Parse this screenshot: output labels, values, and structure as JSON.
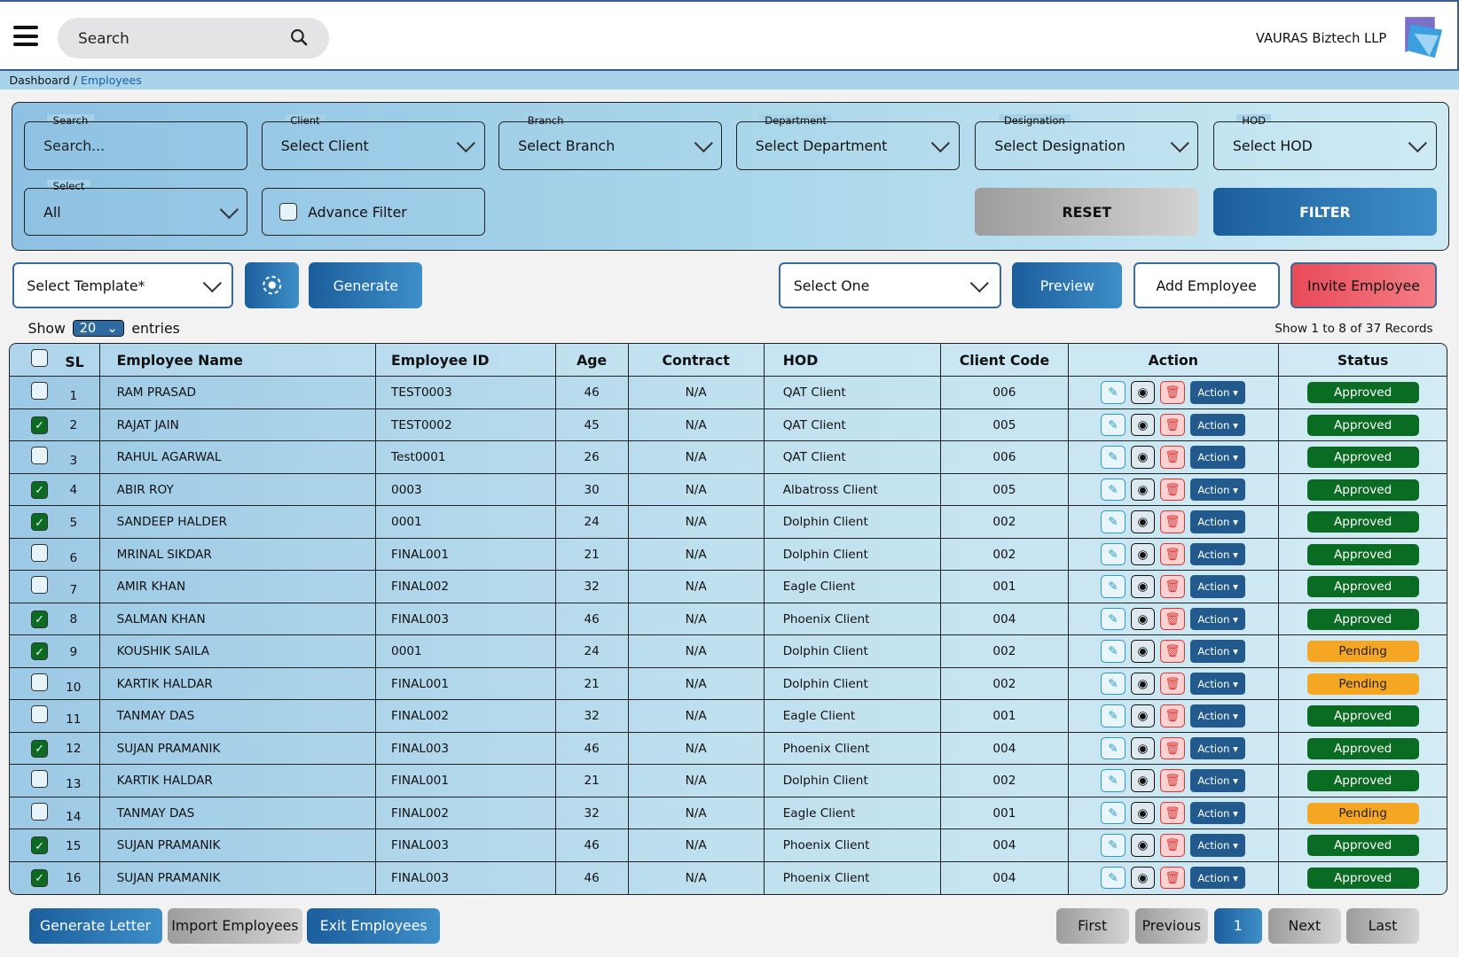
{
  "header": {
    "search_placeholder": "Search",
    "company": "VAURAS Biztech LLP"
  },
  "breadcrumb": {
    "root": "Dashboard",
    "separator": " / ",
    "current": "Employees"
  },
  "filters": {
    "search": {
      "label": "Search",
      "placeholder": "Search..."
    },
    "client": {
      "label": "Client",
      "value": "Select Client"
    },
    "branch": {
      "label": "Branch",
      "value": "Select Branch"
    },
    "department": {
      "label": "Department",
      "value": "Select Department"
    },
    "designation": {
      "label": "Designation",
      "value": "Select Designation"
    },
    "hod": {
      "label": "HOD",
      "value": "Select HOD"
    },
    "select": {
      "label": "Select",
      "value": "All"
    },
    "advance_filter": "Advance Filter",
    "reset": "RESET",
    "filter": "FILTER"
  },
  "toolbar": {
    "template": "Select Template*",
    "generate": "Generate",
    "select_one": "Select One",
    "preview": "Preview",
    "add_employee": "Add Employee",
    "invite_employee": "Invite Employee"
  },
  "entries": {
    "show": "Show",
    "value": "20",
    "entries": "entries",
    "summary": "Show 1 to 8 of 37 Records"
  },
  "table": {
    "headers": [
      "SL",
      "Employee Name",
      "Employee ID",
      "Age",
      "Contract",
      "HOD",
      "Client Code",
      "Action",
      "Status"
    ],
    "action_label": "Action",
    "rows": [
      {
        "checked": false,
        "sl": "1",
        "name": "RAM PRASAD",
        "id": "TEST0003",
        "age": "46",
        "contract": "N/A",
        "hod": "QAT Client",
        "code": "006",
        "status": "Approved"
      },
      {
        "checked": true,
        "sl": "2",
        "name": "RAJAT JAIN",
        "id": "TEST0002",
        "age": "45",
        "contract": "N/A",
        "hod": "QAT Client",
        "code": "005",
        "status": "Approved"
      },
      {
        "checked": false,
        "sl": "3",
        "name": "RAHUL AGARWAL",
        "id": "Test0001",
        "age": "26",
        "contract": "N/A",
        "hod": "QAT Client",
        "code": "006",
        "status": "Approved"
      },
      {
        "checked": true,
        "sl": "4",
        "name": "ABIR ROY",
        "id": "0003",
        "age": "30",
        "contract": "N/A",
        "hod": "Albatross Client",
        "code": "005",
        "status": "Approved"
      },
      {
        "checked": true,
        "sl": "5",
        "name": "SANDEEP HALDER",
        "id": "0001",
        "age": "24",
        "contract": "N/A",
        "hod": "Dolphin Client",
        "code": "002",
        "status": "Approved"
      },
      {
        "checked": false,
        "sl": "6",
        "name": "MRINAL SIKDAR",
        "id": "FINAL001",
        "age": "21",
        "contract": "N/A",
        "hod": "Dolphin Client",
        "code": "002",
        "status": "Approved"
      },
      {
        "checked": false,
        "sl": "7",
        "name": "AMIR KHAN",
        "id": "FINAL002",
        "age": "32",
        "contract": "N/A",
        "hod": "Eagle Client",
        "code": "001",
        "status": "Approved"
      },
      {
        "checked": true,
        "sl": "8",
        "name": "SALMAN KHAN",
        "id": "FINAL003",
        "age": "46",
        "contract": "N/A",
        "hod": "Phoenix Client",
        "code": "004",
        "status": "Approved"
      },
      {
        "checked": true,
        "sl": "9",
        "name": "KOUSHIK SAILA",
        "id": "0001",
        "age": "24",
        "contract": "N/A",
        "hod": "Dolphin Client",
        "code": "002",
        "status": "Pending"
      },
      {
        "checked": false,
        "sl": "10",
        "name": "KARTIK HALDAR",
        "id": "FINAL001",
        "age": "21",
        "contract": "N/A",
        "hod": "Dolphin Client",
        "code": "002",
        "status": "Pending"
      },
      {
        "checked": false,
        "sl": "11",
        "name": "TANMAY DAS",
        "id": "FINAL002",
        "age": "32",
        "contract": "N/A",
        "hod": "Eagle Client",
        "code": "001",
        "status": "Approved"
      },
      {
        "checked": true,
        "sl": "12",
        "name": "SUJAN PRAMANIK",
        "id": "FINAL003",
        "age": "46",
        "contract": "N/A",
        "hod": "Phoenix Client",
        "code": "004",
        "status": "Approved"
      },
      {
        "checked": false,
        "sl": "13",
        "name": "KARTIK HALDAR",
        "id": "FINAL001",
        "age": "21",
        "contract": "N/A",
        "hod": "Dolphin Client",
        "code": "002",
        "status": "Approved"
      },
      {
        "checked": false,
        "sl": "14",
        "name": "TANMAY DAS",
        "id": "FINAL002",
        "age": "32",
        "contract": "N/A",
        "hod": "Eagle Client",
        "code": "001",
        "status": "Pending"
      },
      {
        "checked": true,
        "sl": "15",
        "name": "SUJAN PRAMANIK",
        "id": "FINAL003",
        "age": "46",
        "contract": "N/A",
        "hod": "Phoenix Client",
        "code": "004",
        "status": "Approved"
      },
      {
        "checked": true,
        "sl": "16",
        "name": "SUJAN PRAMANIK",
        "id": "FINAL003",
        "age": "46",
        "contract": "N/A",
        "hod": "Phoenix Client",
        "code": "004",
        "status": "Approved"
      }
    ]
  },
  "status_colors": {
    "Approved": "#0a6b22",
    "Pending": "#f5a623"
  },
  "footer": {
    "generate_letter": "Generate Letter",
    "import_employees": "Import Employees",
    "exit_employees": "Exit Employees"
  },
  "pagination": {
    "first": "First",
    "previous": "Previous",
    "current": "1",
    "next": "Next",
    "last": "Last"
  }
}
